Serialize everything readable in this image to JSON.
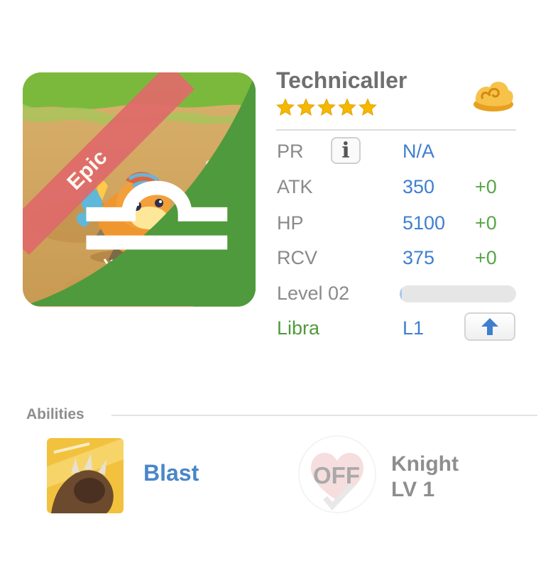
{
  "card": {
    "rarity": "Epic",
    "zodiac_symbol": "libra-glyph"
  },
  "monster": {
    "name": "Technicaller",
    "stars": 5
  },
  "stats": {
    "pr": {
      "label": "PR",
      "value": "N/A"
    },
    "atk": {
      "label": "ATK",
      "value": "350",
      "bonus": "+0"
    },
    "hp": {
      "label": "HP",
      "value": "5100",
      "bonus": "+0"
    },
    "rcv": {
      "label": "RCV",
      "value": "375",
      "bonus": "+0"
    },
    "level": {
      "label": "Level 02",
      "progress": 0.02
    },
    "zodiac": {
      "label": "Libra",
      "value": "L1"
    }
  },
  "info_button": {
    "glyph": "i"
  },
  "abilities": {
    "title": "Abilities",
    "skill": {
      "name": "Blast",
      "icon": "claw-icon"
    },
    "leader": {
      "status": "OFF",
      "name_line1": "Knight",
      "name_line2": "LV 1",
      "icon": "heart-shield-icon"
    }
  },
  "colors": {
    "value_blue": "#3f7fcf",
    "bonus_green": "#56a646",
    "ribbon_red": "#e06a6a",
    "star_gold": "#f5b800"
  }
}
